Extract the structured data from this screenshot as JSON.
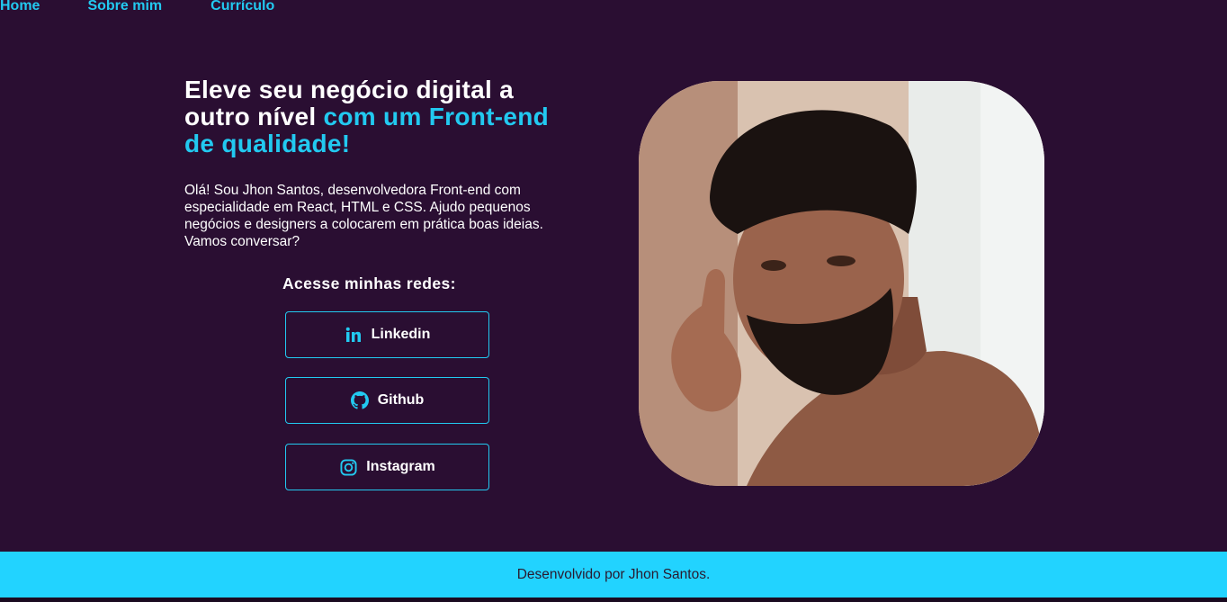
{
  "nav": {
    "items": [
      "Home",
      "Sobre mim",
      "Currículo"
    ]
  },
  "hero": {
    "headline_part1": "Eleve seu negócio digital a outro nível ",
    "headline_accent": "com um Front-end de qualidade!",
    "intro": "Olá! Sou Jhon Santos, desenvolvedora Front-end com especialidade em React, HTML e CSS. Ajudo pequenos negócios e designers a colocarem em prática boas ideias. Vamos conversar?",
    "social_title": "Acesse minhas redes:",
    "buttons": {
      "linkedin": {
        "label": "Linkedin",
        "icon": "linkedin-icon"
      },
      "github": {
        "label": "Github",
        "icon": "github-icon"
      },
      "instagram": {
        "label": "Instagram",
        "icon": "instagram-icon"
      }
    }
  },
  "footer": {
    "text": "Desenvolvido por Jhon Santos."
  },
  "colors": {
    "background": "#2a0e32",
    "accent": "#22c9f0",
    "footer": "#22d3ff"
  }
}
